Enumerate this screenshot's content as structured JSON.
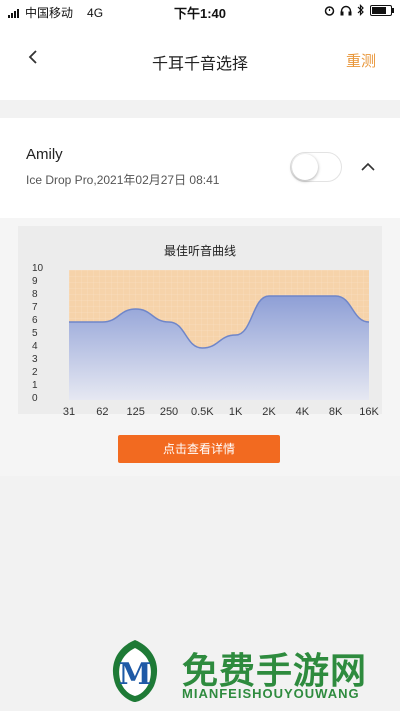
{
  "status_bar": {
    "carrier": "中国移动",
    "network": "4G",
    "time": "下午1:40",
    "battery_level": 0.85
  },
  "nav": {
    "title": "千耳千音选择",
    "retest_label": "重测"
  },
  "profile": {
    "name": "Amily",
    "device_info": "Ice Drop Pro,2021年02月27日 08:41",
    "toggle_on": false
  },
  "chart_data": {
    "type": "area",
    "title": "最佳听音曲线",
    "x": [
      "31",
      "62",
      "125",
      "250",
      "0.5K",
      "1K",
      "2K",
      "4K",
      "8K",
      "16K"
    ],
    "y_ticks": [
      "10",
      "9",
      "8",
      "7",
      "6",
      "5",
      "4",
      "3",
      "2",
      "1",
      "0"
    ],
    "values": [
      6,
      6,
      7,
      6,
      4,
      5,
      8,
      8,
      8,
      6
    ],
    "ylim": [
      0,
      10
    ],
    "colors": {
      "upper_fill": "#f6d3aa",
      "curve_fill_top": "#8e9fd6",
      "curve_fill_bottom": "#e6e8f2",
      "line": "#6f86c9"
    }
  },
  "detail_button": {
    "label": "点击查看详情"
  },
  "watermark": {
    "text": "免费手游网",
    "subtext": "MIANFEISHOUYOUWANG",
    "logo_letter": "M"
  },
  "colors": {
    "accent": "#e8963a",
    "button": "#f26a20"
  }
}
